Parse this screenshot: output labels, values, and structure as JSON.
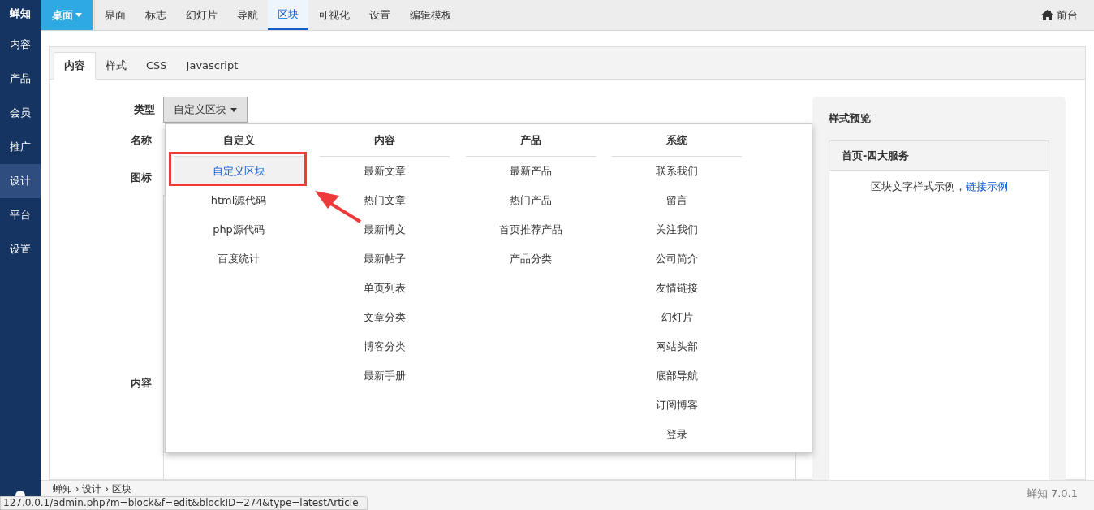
{
  "sidebar": {
    "brand": "蝉知",
    "items": [
      {
        "label": "内容",
        "selected": false
      },
      {
        "label": "产品",
        "selected": false
      },
      {
        "label": "会员",
        "selected": false
      },
      {
        "label": "推广",
        "selected": false
      },
      {
        "label": "设计",
        "selected": true
      },
      {
        "label": "平台",
        "selected": false
      },
      {
        "label": "设置",
        "selected": false
      }
    ]
  },
  "topnav": {
    "menu_button": "桌面",
    "tabs": [
      {
        "label": "界面",
        "selected": false
      },
      {
        "label": "标志",
        "selected": false
      },
      {
        "label": "幻灯片",
        "selected": false
      },
      {
        "label": "导航",
        "selected": false
      },
      {
        "label": "区块",
        "selected": true
      },
      {
        "label": "可视化",
        "selected": false
      },
      {
        "label": "设置",
        "selected": false
      },
      {
        "label": "编辑模板",
        "selected": false
      }
    ],
    "frontend_link": "前台"
  },
  "editor_tabs": [
    {
      "label": "内容",
      "selected": true
    },
    {
      "label": "样式",
      "selected": false
    },
    {
      "label": "CSS",
      "selected": false
    },
    {
      "label": "Javascript",
      "selected": false
    }
  ],
  "form": {
    "labels": [
      "类型",
      "名称",
      "图标",
      "内容"
    ],
    "type_button": "自定义区块"
  },
  "type_menu": {
    "columns": [
      {
        "heading": "自定义",
        "items": [
          {
            "label": "自定义区块",
            "selected": true
          },
          {
            "label": "html源代码",
            "selected": false
          },
          {
            "label": "php源代码",
            "selected": false
          },
          {
            "label": "百度统计",
            "selected": false
          }
        ]
      },
      {
        "heading": "内容",
        "items": [
          {
            "label": "最新文章",
            "selected": false
          },
          {
            "label": "热门文章",
            "selected": false
          },
          {
            "label": "最新博文",
            "selected": false
          },
          {
            "label": "最新帖子",
            "selected": false
          },
          {
            "label": "单页列表",
            "selected": false
          },
          {
            "label": "文章分类",
            "selected": false
          },
          {
            "label": "博客分类",
            "selected": false
          },
          {
            "label": "最新手册",
            "selected": false
          }
        ]
      },
      {
        "heading": "产品",
        "items": [
          {
            "label": "最新产品",
            "selected": false
          },
          {
            "label": "热门产品",
            "selected": false
          },
          {
            "label": "首页推荐产品",
            "selected": false
          },
          {
            "label": "产品分类",
            "selected": false
          }
        ]
      },
      {
        "heading": "系统",
        "items": [
          {
            "label": "联系我们",
            "selected": false
          },
          {
            "label": "留言",
            "selected": false
          },
          {
            "label": "关注我们",
            "selected": false
          },
          {
            "label": "公司简介",
            "selected": false
          },
          {
            "label": "友情链接",
            "selected": false
          },
          {
            "label": "幻灯片",
            "selected": false
          },
          {
            "label": "网站头部",
            "selected": false
          },
          {
            "label": "底部导航",
            "selected": false
          },
          {
            "label": "订阅博客",
            "selected": false
          },
          {
            "label": "登录",
            "selected": false
          }
        ]
      }
    ]
  },
  "preview": {
    "title": "样式预览",
    "card_title": "首页-四大服务",
    "sample_text": "区块文字样式示例，",
    "sample_link": "链接示例"
  },
  "footer": {
    "breadcrumb": "蝉知 › 设计 › 区块",
    "version": "蝉知 7.0.1"
  },
  "status_url": "127.0.0.1/admin.php?m=block&f=edit&blockID=274&type=latestArticle"
}
